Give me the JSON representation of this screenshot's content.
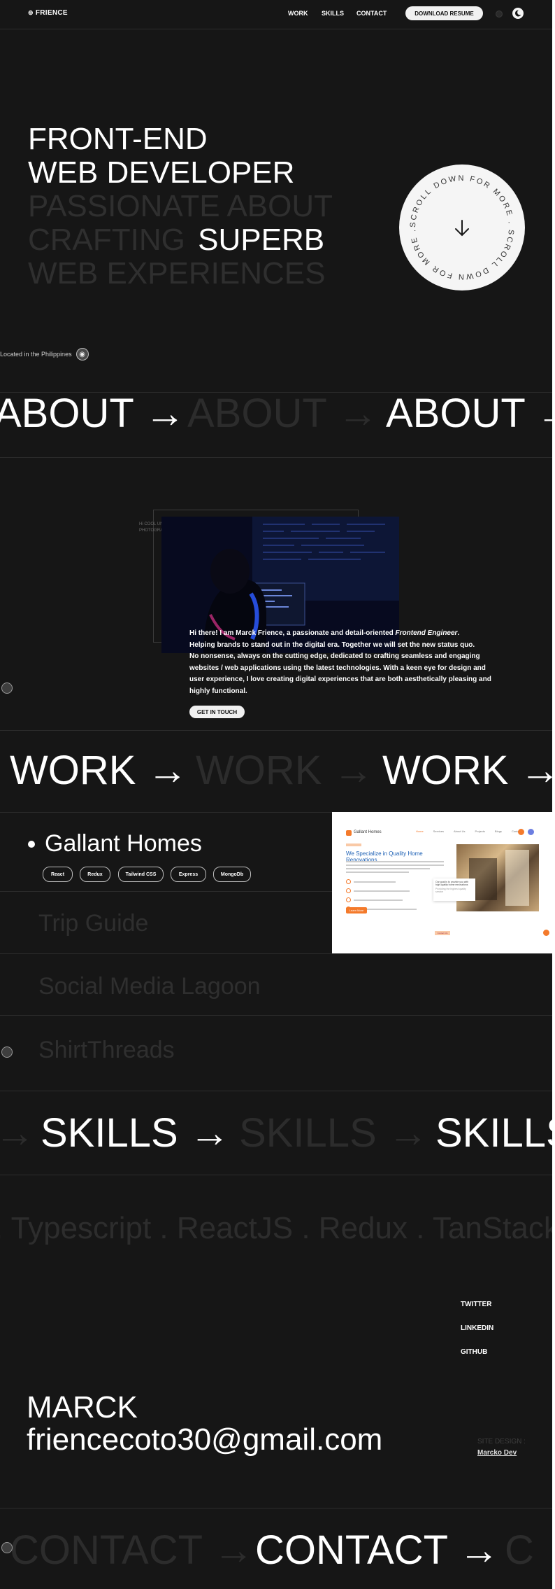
{
  "nav": {
    "logo": "FRIENCE",
    "links": [
      "WORK",
      "SKILLS",
      "CONTACT"
    ],
    "resume_button": "DOWNLOAD RESUME"
  },
  "hero": {
    "line1": "FRONT-END",
    "line2": "WEB DEVELOPER",
    "line3": "PASSIONATE ABOUT",
    "line4_dim": "CRAFTING",
    "line4_bright": "SUPERB",
    "line5": "WEB EXPERIENCES",
    "scroll_badge": "SCROLL DOWN FOR MORE . SCROLL DOWN FOR MORE .",
    "location": "Located in the Philippines"
  },
  "about": {
    "marquee": [
      "ABOUT →",
      "ABOUT →",
      "ABOUT →"
    ],
    "image_caption_1": "Hi COOL UNSPLASH",
    "image_caption_2": "PHOTOGRAPHY",
    "intro": "Hi there! I am Marck Frience, a passionate and detail-oriented",
    "role": "Frontend Engineer",
    "intro_end": ".",
    "line2": "Helping brands to stand out in the digital era. Together we will set the new status quo.",
    "line3": "No nonsense, always on the cutting edge, dedicated to crafting seamless and engaging websites / web applications using the latest technologies. With a keen eye for design and user experience, I love creating digital experiences that are both aesthetically pleasing and highly functional.",
    "cta": "GET IN TOUCH"
  },
  "work": {
    "marquee": [
      "WORK →",
      "WORK →",
      "WORK →"
    ],
    "projects": [
      {
        "title": "Gallant Homes",
        "tags": [
          "React",
          "Redux",
          "Tailwind CSS",
          "Express",
          "MongoDb"
        ]
      },
      {
        "title": "Trip Guide"
      },
      {
        "title": "Social Media Lagoon"
      },
      {
        "title": "ShirtThreads"
      }
    ],
    "preview": {
      "brand": "Gallant Homes",
      "nav": [
        "Home",
        "Services",
        "About Us",
        "Projects",
        "Blogs",
        "Contact"
      ],
      "heading": "We Specialize in Quality Home Renovations",
      "button": "Learn More",
      "quote": "Our goal is to provide you with high quality home renovations",
      "quote_sub": "Providing the highest quality service",
      "contact_button": "Contact Us"
    }
  },
  "skills": {
    "marquee": [
      "→",
      "SKILLS →",
      "SKILLS →",
      "SKILLS"
    ],
    "ticker": ". Typescript . ReactJS . Redux . TanStack ."
  },
  "footer": {
    "social": [
      "TWITTER",
      "LINKEDIN",
      "GITHUB"
    ],
    "name": "MARCK",
    "email": "friencecoto30@gmail.com",
    "credit_label": "SITE DESIGN :",
    "credit_name": "Marcko Dev",
    "marquee": [
      "CONTACT →",
      "CONTACT →",
      "C"
    ]
  },
  "colors": {
    "background": "#161616",
    "accent": "#f47a2b",
    "text": "#ffffff",
    "dim": "#2f2f2f"
  }
}
